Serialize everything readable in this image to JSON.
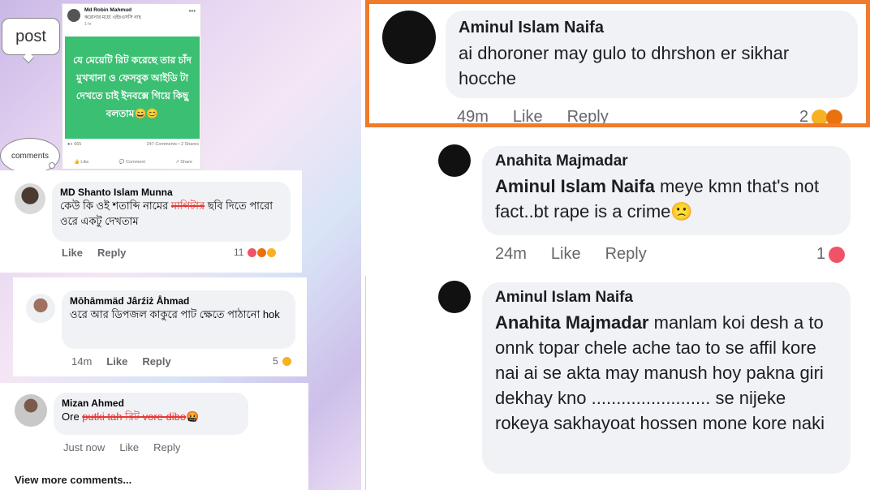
{
  "left": {
    "post_bubble": "post",
    "comments_cloud": "comments",
    "post": {
      "author": "Md Robin Mahmud",
      "subtitle": "করোনার মধ্যে এইচএসসি নাহ",
      "time": "1 hr",
      "image_text": "যে মেয়েটি রিট করেছে তার চাঁদ মুখখানা ও ফেসবুক আইডি টা দেখতে চাই ইনবক্সে গিয়ে কিছু বলতাম😄😊",
      "reactions_count": "665",
      "stats": "247 Comments • 2 Shares",
      "like": "Like",
      "comment": "Comment",
      "share": "Share"
    },
    "comments": [
      {
        "name": "MD Shanto Islam Munna",
        "text_before": "কেউ কি ওই শতাব্দি নামের ",
        "text_struck": "মাগিটার",
        "text_after": "  ছবি দিতে পারো ওরে একটু দেখতাম",
        "like": "Like",
        "reply": "Reply",
        "reactions": "11"
      },
      {
        "name": "Mōhāmmäd Jârźiż Åhmad",
        "text": "ওরে আর ডিপজল কাকুরে পাট ক্ষেতে পাঠানো hok",
        "time": "14m",
        "like": "Like",
        "reply": "Reply",
        "reactions": "5"
      },
      {
        "name": "Mizan Ahmed",
        "text_before": "Ore ",
        "text_struck": "putki tah রিট vore dibo",
        "text_after": "🤬",
        "time": "Just now",
        "like": "Like",
        "reply": "Reply"
      }
    ],
    "view_more": "View more comments..."
  },
  "right": {
    "comments": [
      {
        "name": "Aminul Islam Naifa",
        "text": "ai dhoroner may gulo to dhrshon er sikhar hocche",
        "time": "49m",
        "like": "Like",
        "reply": "Reply",
        "reactions": "2"
      },
      {
        "name": "Anahita Majmadar",
        "mention": "Aminul Islam Naifa",
        "text": " meye kmn that's not fact..bt rape is a crime🙁",
        "time": "24m",
        "like": "Like",
        "reply": "Reply",
        "reactions": "1"
      },
      {
        "name": "Aminul Islam Naifa",
        "mention": "Anahita Majmadar",
        "text": " manlam koi desh a to onnk topar chele ache tao to se affil kore nai ai se akta may manush hoy pakna giri dekhay kno ........................ se nijeke rokeya sakhayoat hossen mone kore naki"
      }
    ]
  },
  "colors": {
    "highlight_border": "#f07b2a",
    "post_green": "#3bbf72",
    "strike_red": "#e53935",
    "bubble_gray": "#f0f2f5"
  }
}
